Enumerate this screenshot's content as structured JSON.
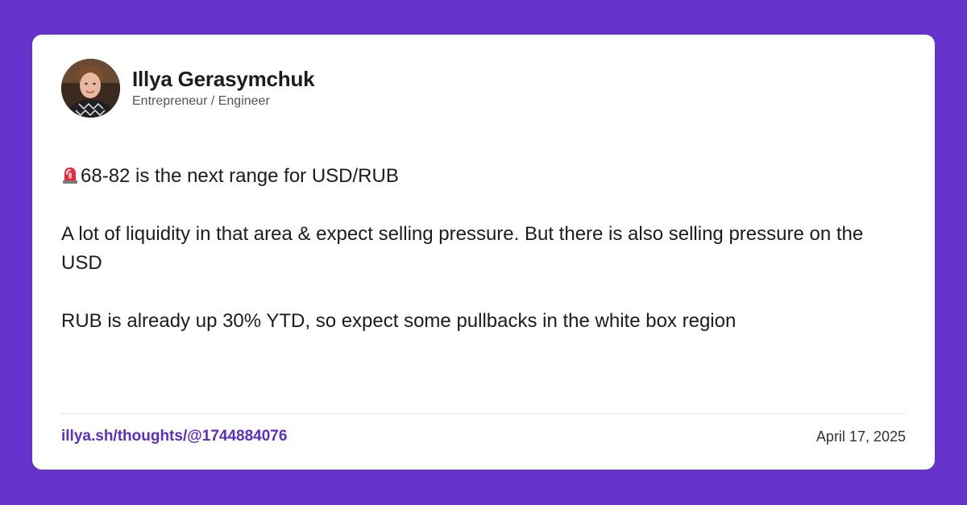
{
  "author": {
    "name": "Illya Gerasymchuk",
    "role": "Entrepreneur / Engineer",
    "avatar_icon": "profile-photo"
  },
  "post": {
    "emoji_icon": "rotating-light-icon",
    "paragraphs": [
      "68-82 is the next range for USD/RUB",
      "A lot of liquidity in that area & expect selling pressure. But there is also selling pressure on the USD",
      "RUB is already up 30% YTD, so expect some pullbacks in the white box region"
    ]
  },
  "footer": {
    "link": "illya.sh/thoughts/@1744884076",
    "date": "April 17, 2025"
  },
  "colors": {
    "background": "#6633cc",
    "card": "#ffffff",
    "link": "#5b2ec4"
  }
}
